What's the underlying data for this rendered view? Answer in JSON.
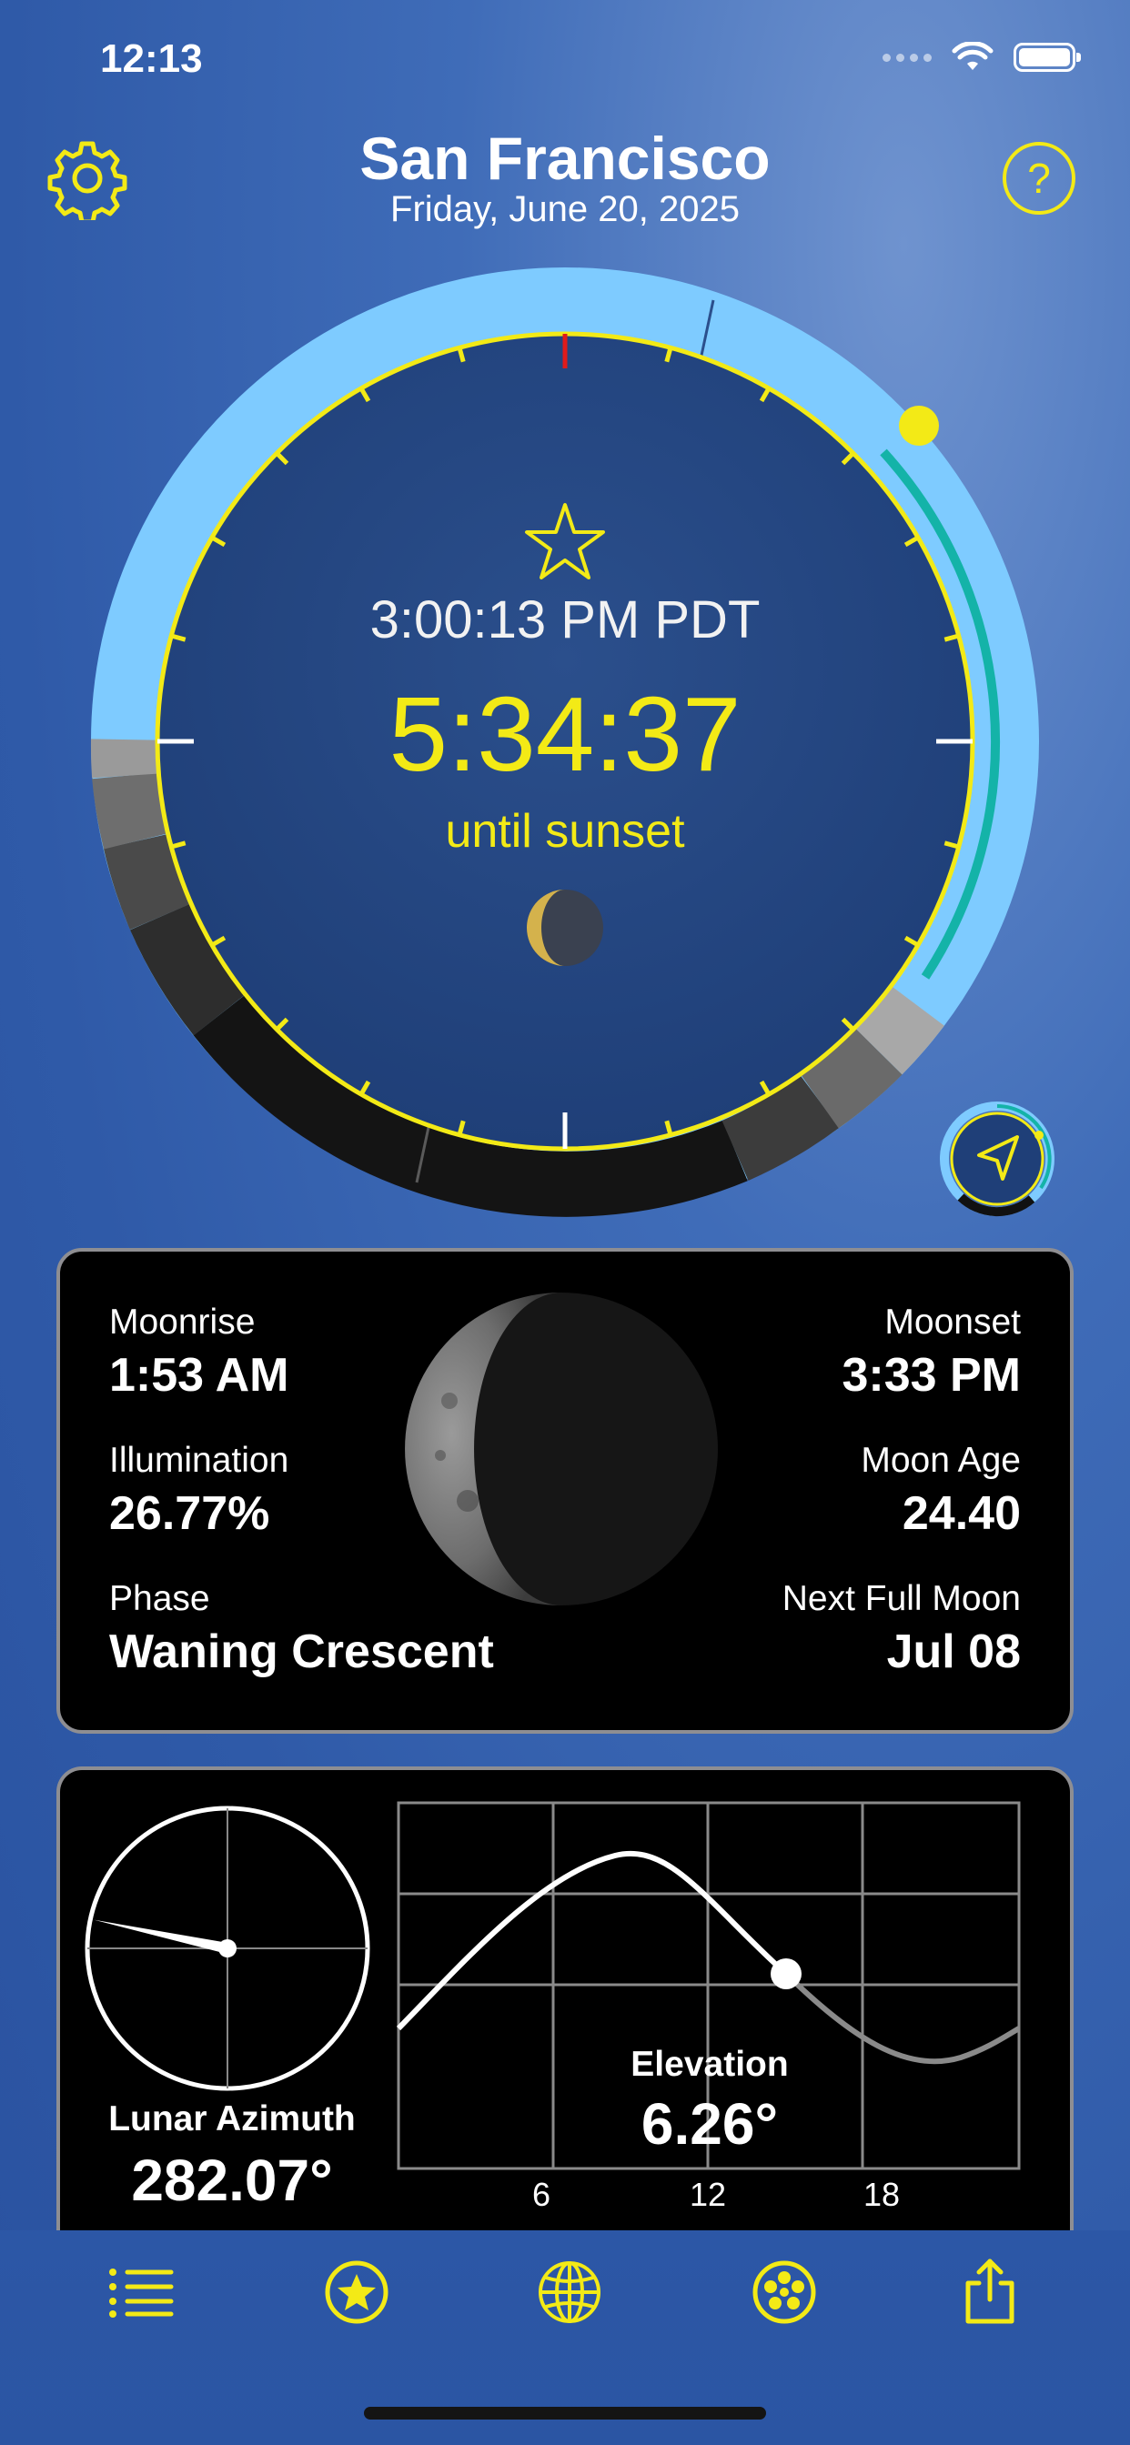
{
  "status": {
    "time": "12:13"
  },
  "header": {
    "city": "San Francisco",
    "date": "Friday, June 20, 2025"
  },
  "dial": {
    "local_time": "3:00:13 PM PDT",
    "countdown": "5:34:37",
    "countdown_caption": "until sunset"
  },
  "moon": {
    "moonrise_label": "Moonrise",
    "moonrise": "1:53 AM",
    "moonset_label": "Moonset",
    "moonset": "3:33 PM",
    "illumination_label": "Illumination",
    "illumination": "26.77%",
    "age_label": "Moon Age",
    "age": "24.40",
    "phase_label": "Phase",
    "phase": "Waning Crescent",
    "next_full_label": "Next Full Moon",
    "next_full": "Jul 08",
    "illuminated_fraction": 0.2677
  },
  "position": {
    "azimuth_label": "Lunar Azimuth",
    "azimuth": "282.07°",
    "azimuth_deg": 282.07,
    "elevation_label": "Elevation",
    "elevation": "6.26°",
    "x_ticks": [
      "6",
      "12",
      "18"
    ]
  },
  "tabs": [
    {
      "name": "list-icon"
    },
    {
      "name": "star-icon"
    },
    {
      "name": "globe-icon"
    },
    {
      "name": "moon-phases-icon"
    },
    {
      "name": "share-icon"
    }
  ],
  "colors": {
    "accent": "#f3ea16",
    "day_ring": "#7ecbff",
    "sun_path": "#14b3a8",
    "panel_bg": "#000000"
  }
}
